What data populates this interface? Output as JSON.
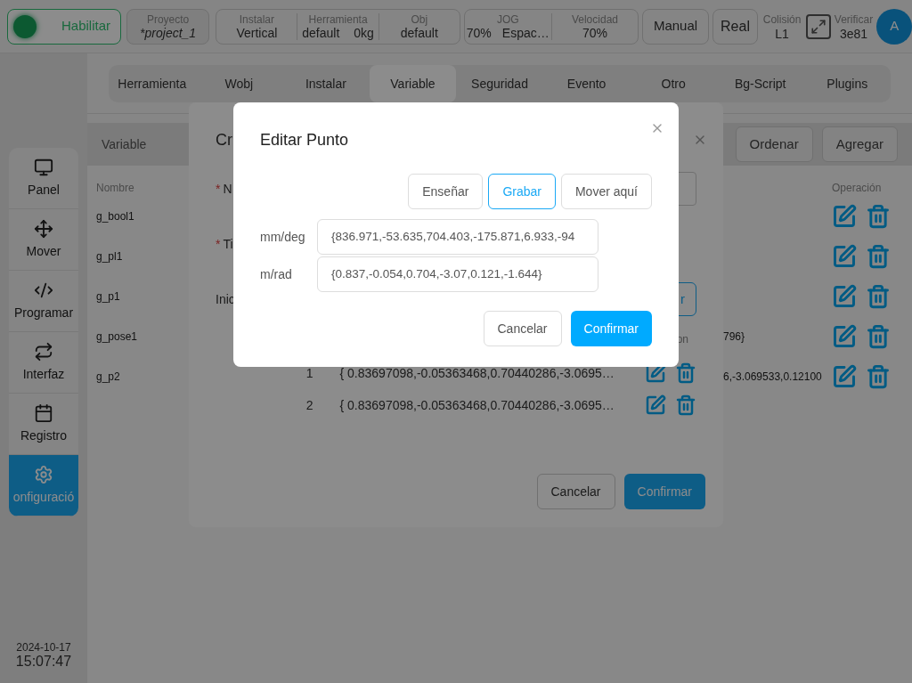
{
  "top_bar": {
    "enable_button": {
      "label": "Habilitar",
      "on": true
    },
    "project": {
      "label": "Proyecto",
      "value": "*project_1"
    },
    "install_group": [
      {
        "label": "Instalar",
        "values": [
          "Vertical"
        ]
      },
      {
        "label": "Herramienta",
        "values": [
          "default",
          "0kg"
        ]
      },
      {
        "label": "Obj",
        "values": [
          "default"
        ]
      }
    ],
    "jog_group": [
      {
        "label": "JOG",
        "values": [
          "70%",
          "Espac…"
        ]
      },
      {
        "label": "Velocidad",
        "values": [
          "70%"
        ]
      }
    ],
    "mode_button": "Manual",
    "real_button": "Real",
    "collision": {
      "label": "Colisión",
      "value": "L1"
    },
    "verify": {
      "label": "Verificar",
      "value": "3e81"
    },
    "avatar": "A"
  },
  "sidebar": {
    "items": [
      {
        "label": "Panel",
        "selected": false
      },
      {
        "label": "Mover",
        "selected": false
      },
      {
        "label": "Programar",
        "selected": false
      },
      {
        "label": "Interfaz",
        "selected": false
      },
      {
        "label": "Registro",
        "selected": false
      },
      {
        "label": "onfiguració",
        "selected": true
      }
    ],
    "date": "2024-10-17",
    "time": "15:07:47"
  },
  "settings_tabs": [
    {
      "label": "Herramienta",
      "selected": false
    },
    {
      "label": "Wobj",
      "selected": false
    },
    {
      "label": "Instalar",
      "selected": false
    },
    {
      "label": "Variable",
      "selected": true
    },
    {
      "label": "Seguridad",
      "selected": false
    },
    {
      "label": "Evento",
      "selected": false
    },
    {
      "label": "Otro",
      "selected": false
    },
    {
      "label": "Bg-Script",
      "selected": false
    },
    {
      "label": "Plugins",
      "selected": false
    }
  ],
  "variable_panel": {
    "title": "Variable",
    "buttons": [
      "Ordenar",
      "Agregar"
    ],
    "columns": [
      "Nombre",
      "Operación"
    ],
    "rows": [
      {
        "name": "g_bool1"
      },
      {
        "name": "g_pl1"
      },
      {
        "name": "g_p1"
      },
      {
        "name": "g_pose1",
        "value": "796}"
      },
      {
        "name": "g_p2",
        "value": "6,-3.069533,0.12100"
      }
    ]
  },
  "create_dialog": {
    "title": "Cr",
    "fields": [
      {
        "marker": "*",
        "label": "N"
      },
      {
        "marker": "*",
        "label": "Ti"
      }
    ],
    "init_label": "Inic",
    "button_fragment": "r",
    "header_fragment": "on",
    "rows": [
      {
        "index": "1",
        "value": "{ 0.83697098,-0.05363468,0.70440286,-3.0695…"
      },
      {
        "index": "2",
        "value": "{ 0.83697098,-0.05363468,0.70440286,-3.0695…"
      }
    ],
    "buttons": [
      "Cancelar",
      "Confirmar"
    ]
  },
  "edit_dialog": {
    "title": "Editar Punto",
    "actions": [
      {
        "label": "Enseñar",
        "selected": false
      },
      {
        "label": "Grabar",
        "selected": true
      },
      {
        "label": "Mover aquí",
        "selected": false
      }
    ],
    "fields": [
      {
        "label": "mm/deg",
        "value": "{836.971,-53.635,704.403,-175.871,6.933,-94"
      },
      {
        "label": "m/rad",
        "value": "{0.837,-0.054,0.704,-3.07,0.121,-1.644}"
      }
    ],
    "buttons": [
      "Cancelar",
      "Confirmar"
    ]
  }
}
